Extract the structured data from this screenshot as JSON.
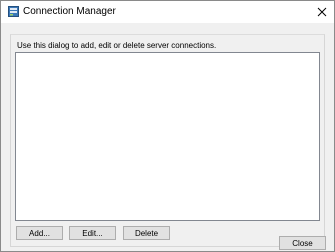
{
  "window": {
    "title": "Connection Manager",
    "app_icon": "server-connection-icon",
    "close_icon": "close-icon"
  },
  "dialog": {
    "instructions": "Use this dialog to add, edit or delete server connections.",
    "connections": [],
    "buttons": {
      "add": "Add...",
      "edit": "Edit...",
      "delete": "Delete",
      "close": "Close"
    }
  },
  "colors": {
    "window_bg": "#f0f0f0",
    "titlebar_bg": "#ffffff",
    "button_bg": "#e1e1e1",
    "button_border": "#adadad",
    "listbox_border": "#828790"
  }
}
